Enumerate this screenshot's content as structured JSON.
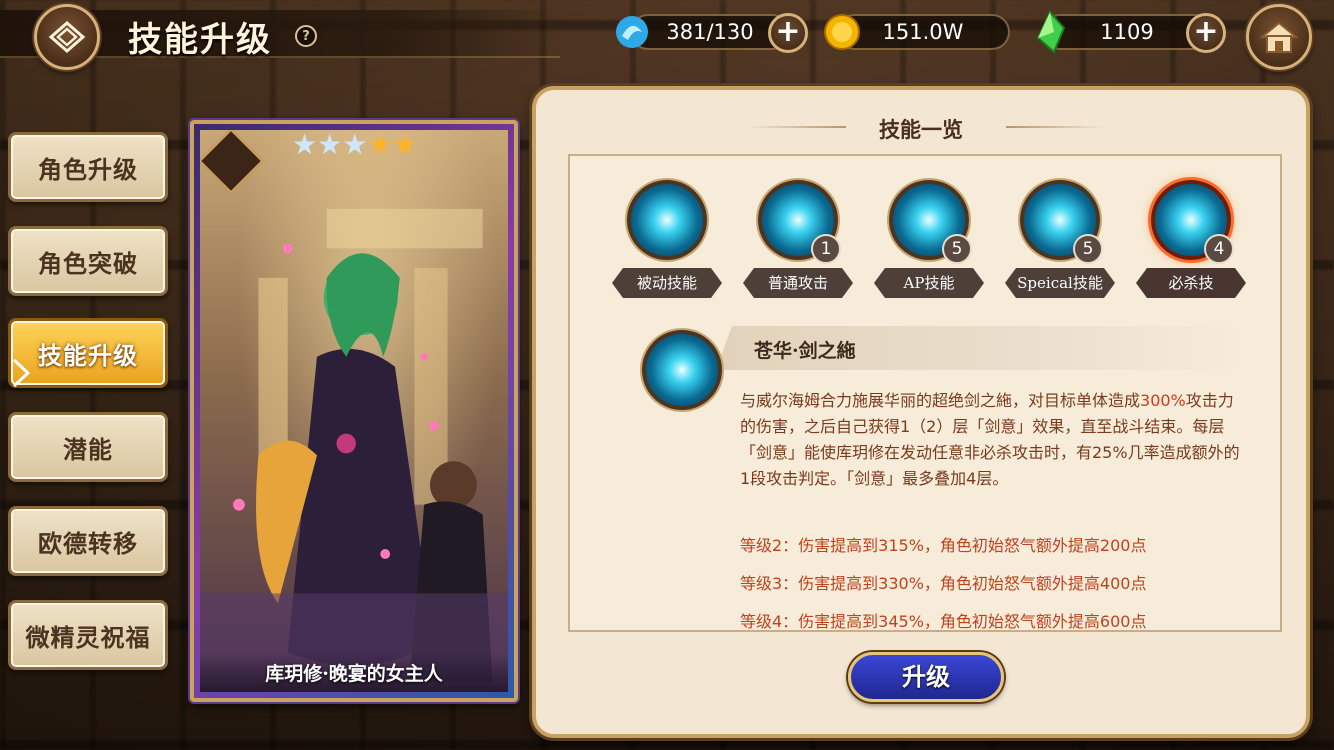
{
  "header": {
    "title": "技能升级",
    "help_label": "?",
    "resources": [
      {
        "name": "stamina",
        "icon": "water-drop-icon",
        "value": "381/130"
      },
      {
        "name": "gold",
        "icon": "gold-coin-icon",
        "value": "151.0W"
      },
      {
        "name": "gem",
        "icon": "green-crystal-icon",
        "value": "1109"
      }
    ],
    "plus_label": "+"
  },
  "menu": {
    "items": [
      {
        "label": "角色升级",
        "active": false
      },
      {
        "label": "角色突破",
        "active": false
      },
      {
        "label": "技能升级",
        "active": true
      },
      {
        "label": "潜能",
        "active": false
      },
      {
        "label": "欧德转移",
        "active": false
      },
      {
        "label": "微精灵祝福",
        "active": false
      }
    ]
  },
  "character": {
    "name": "库玥修·晚宴的女主人",
    "stars": 5,
    "element_icon": "mountain-element-icon"
  },
  "panel": {
    "title": "技能一览",
    "skills": [
      {
        "label": "被动技能",
        "level": ""
      },
      {
        "label": "普通攻击",
        "level": "1"
      },
      {
        "label": "AP技能",
        "level": "5"
      },
      {
        "label": "Speical技能",
        "level": "5"
      },
      {
        "label": "必杀技",
        "level": "4",
        "selected": true
      }
    ],
    "detail": {
      "name": "苍华·剑之絁",
      "desc_1": "与威尔海姆合力施展华丽的超绝剑之絁，对目标单体造成",
      "desc_red": "300%",
      "desc_2": "攻击力的伤害，之后自己获得1（2）层「剑意」效果，直至战斗结束。每层「剑意」能使库玥修在发动任意非必杀攻击时，有25%几率造成额外的1段攻击判定。「剑意」最多叠加4层。",
      "levels": [
        "等级2：伤害提高到315%，角色初始怒气额外提高200点",
        "等级3：伤害提高到330%，角色初始怒气额外提高400点",
        "等级4：伤害提高到345%，角色初始怒气额外提高600点"
      ]
    },
    "upgrade_label": "升级"
  }
}
